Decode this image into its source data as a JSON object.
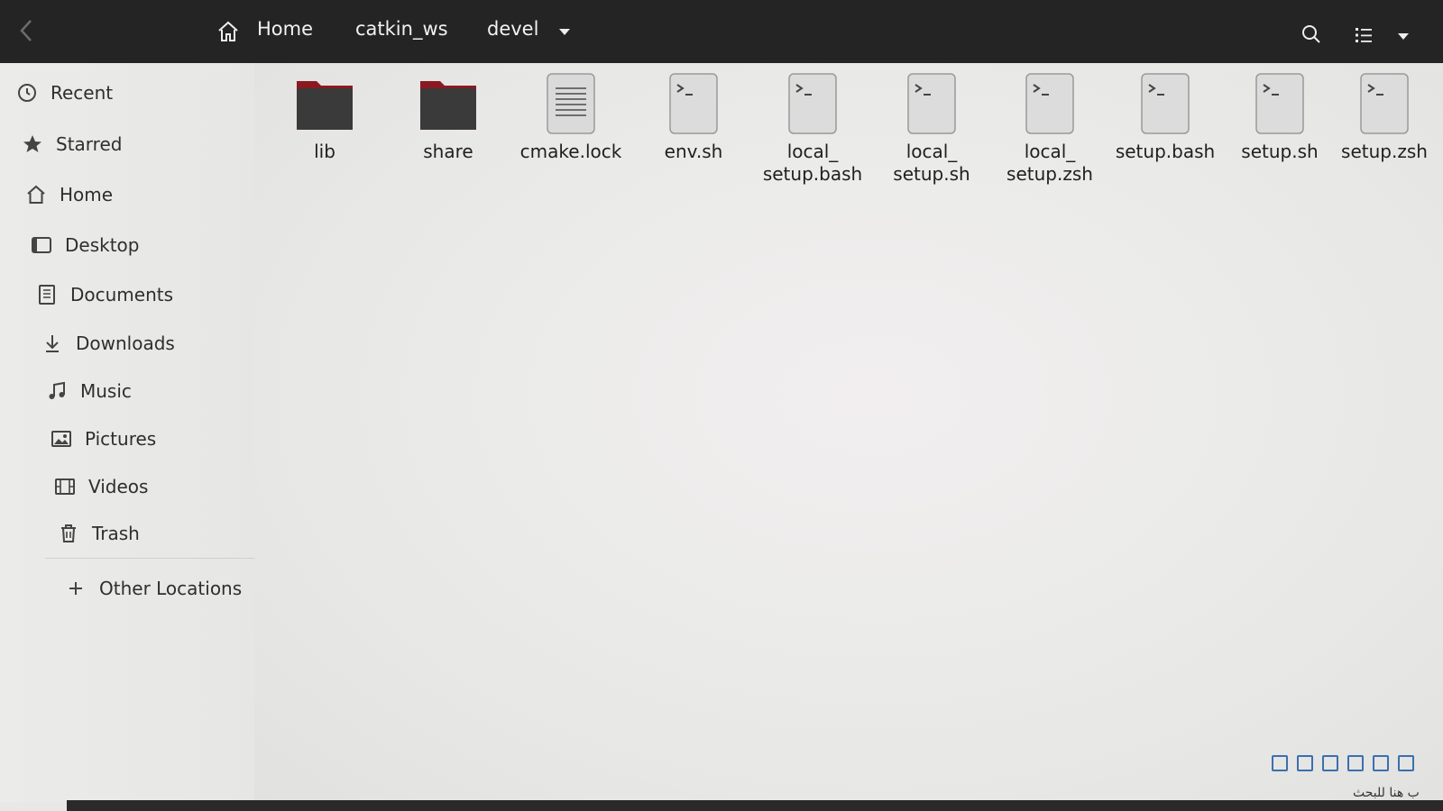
{
  "header": {
    "breadcrumbs": [
      "Home",
      "catkin_ws",
      "devel"
    ]
  },
  "sidebar": {
    "items": [
      {
        "label": "Recent",
        "icon": "recent-icon"
      },
      {
        "label": "Starred",
        "icon": "star-icon"
      },
      {
        "label": "Home",
        "icon": "home-icon"
      },
      {
        "label": "Desktop",
        "icon": "desktop-icon"
      },
      {
        "label": "Documents",
        "icon": "documents-icon"
      },
      {
        "label": "Downloads",
        "icon": "downloads-icon"
      },
      {
        "label": "Music",
        "icon": "music-icon"
      },
      {
        "label": "Pictures",
        "icon": "pictures-icon"
      },
      {
        "label": "Videos",
        "icon": "videos-icon"
      },
      {
        "label": "Trash",
        "icon": "trash-icon"
      }
    ],
    "other_locations": "Other Locations"
  },
  "files": [
    {
      "name": "lib",
      "type": "folder"
    },
    {
      "name": "share",
      "type": "folder"
    },
    {
      "name": "cmake.lock",
      "type": "text"
    },
    {
      "name": "env.sh",
      "type": "script"
    },
    {
      "name": "local_ setup.bash",
      "type": "script"
    },
    {
      "name": "local_ setup.sh",
      "type": "script"
    },
    {
      "name": "local_ setup.zsh",
      "type": "script"
    },
    {
      "name": "setup.bash",
      "type": "script"
    },
    {
      "name": "setup.sh",
      "type": "script"
    },
    {
      "name": "setup.zsh",
      "type": "script"
    }
  ],
  "taskbar": {
    "search_text": "ب هنا للبحث"
  },
  "colors": {
    "headerbar": "#242424",
    "folder": "#3a3a3a",
    "folder_tab": "#8a1a22",
    "sidebar": "#e9e9e7",
    "content": "#ececea"
  }
}
